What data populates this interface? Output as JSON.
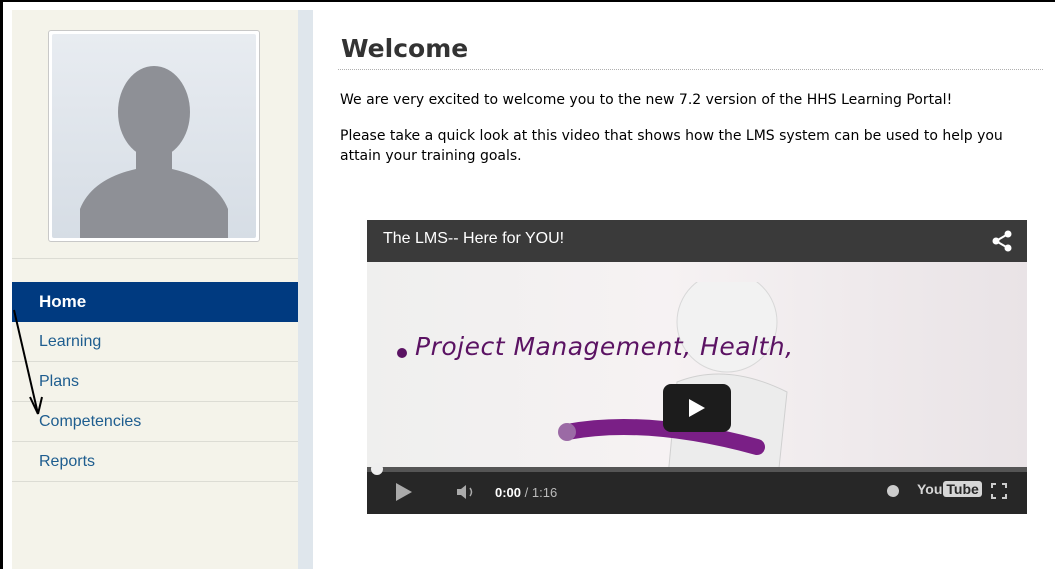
{
  "sidebar": {
    "avatar_alt": "profile picture placeholder",
    "nav": [
      {
        "label": "Home",
        "active": true
      },
      {
        "label": "Learning",
        "active": false
      },
      {
        "label": "Plans",
        "active": false
      },
      {
        "label": "Competencies",
        "active": false
      },
      {
        "label": "Reports",
        "active": false
      }
    ]
  },
  "main": {
    "title": "Welcome",
    "paragraph_1": "We are very excited to welcome you to the new 7.2 version of the HHS Learning Portal!",
    "paragraph_2": "Please take a quick look at this video that shows how the LMS system can be used to help you attain your training goals."
  },
  "video": {
    "title": "The LMS-- Here for YOU!",
    "frame_text": "Project Management, Health,",
    "time_current": "0:00",
    "time_separator": " / ",
    "time_total": "1:16",
    "logo_you": "You",
    "logo_tube": "Tube",
    "progress_fraction": 0.0
  },
  "colors": {
    "nav_active_bg": "#003a80",
    "nav_link": "#1e5d8f",
    "sidebar_bg": "#f4f3ea",
    "handwriting": "#5b1363"
  }
}
